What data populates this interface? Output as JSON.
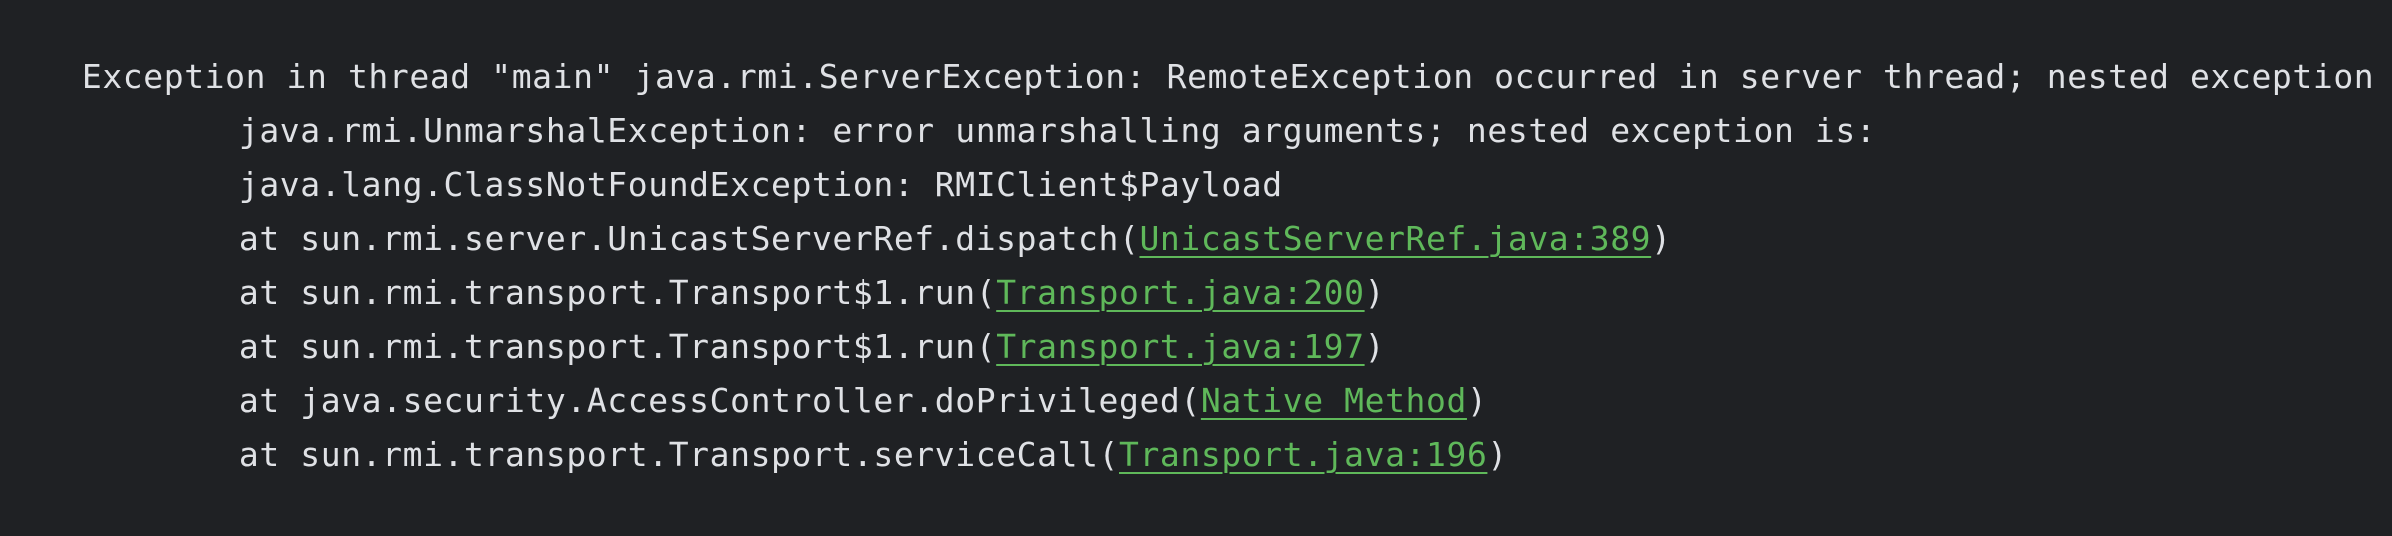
{
  "console": {
    "header": "Exception in thread \"main\" java.rmi.ServerException: RemoteException occurred in server thread; nested exception is:",
    "nested": [
      "java.rmi.UnmarshalException: error unmarshalling arguments; nested exception is:",
      "java.lang.ClassNotFoundException: RMIClient$Payload"
    ],
    "frames": [
      {
        "prefix": "at sun.rmi.server.UnicastServerRef.dispatch(",
        "location": "UnicastServerRef.java:389",
        "suffix": ")"
      },
      {
        "prefix": "at sun.rmi.transport.Transport$1.run(",
        "location": "Transport.java:200",
        "suffix": ")"
      },
      {
        "prefix": "at sun.rmi.transport.Transport$1.run(",
        "location": "Transport.java:197",
        "suffix": ")"
      },
      {
        "prefix": "at java.security.AccessController.doPrivileged(",
        "location": "Native Method",
        "suffix": ")"
      },
      {
        "prefix": "at sun.rmi.transport.Transport.serviceCall(",
        "location": "Transport.java:196",
        "suffix": ")"
      }
    ]
  },
  "colors": {
    "background": "#1f2124",
    "text": "#dfe1e5",
    "link": "#5fb85a"
  }
}
